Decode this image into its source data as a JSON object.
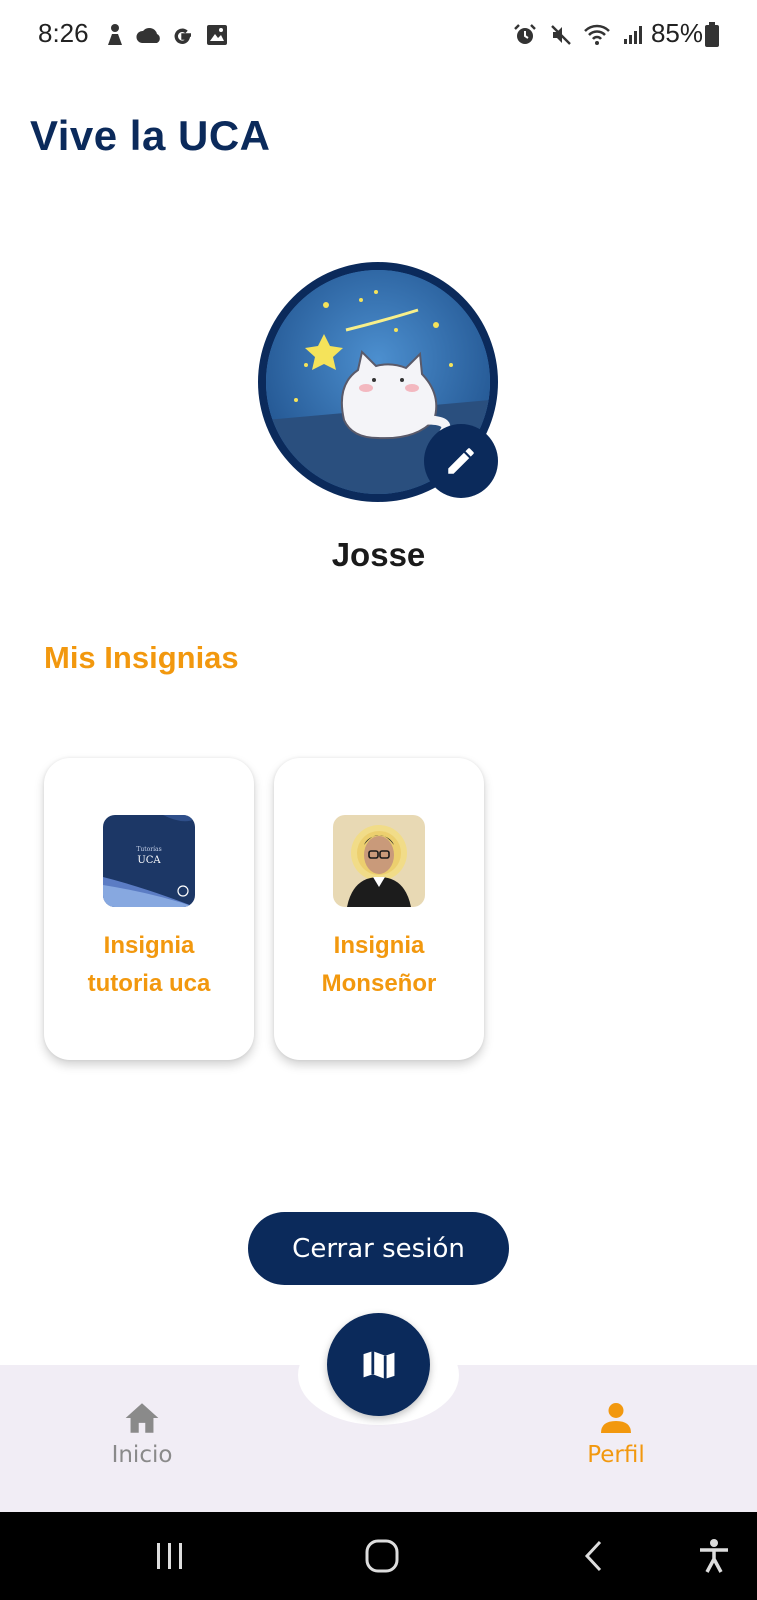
{
  "status_bar": {
    "time": "8:26",
    "battery": "85%"
  },
  "header": {
    "title": "Vive la UCA"
  },
  "profile": {
    "name": "Josse",
    "avatar_icon": "cat-shooting-star-avatar",
    "edit_icon": "pencil-icon"
  },
  "badges": {
    "title": "Mis Insignias",
    "items": [
      {
        "label": "Insignia tutoria uca",
        "image_text_small": "Tutorías",
        "image_text": "UCA"
      },
      {
        "label": "Insignia Monseñor"
      }
    ]
  },
  "actions": {
    "logout_label": "Cerrar sesión"
  },
  "bottom_nav": {
    "home_label": "Inicio",
    "profile_label": "Perfil",
    "fab_icon": "map-icon"
  },
  "colors": {
    "primary": "#0b2a5b",
    "accent": "#f2980e",
    "nav_background": "#f1edf5",
    "inactive": "#8a8a8a"
  }
}
